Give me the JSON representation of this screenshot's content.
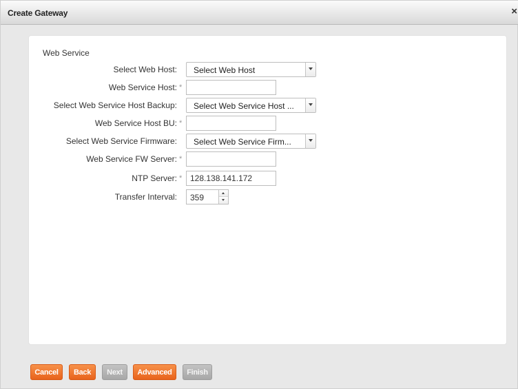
{
  "window": {
    "title": "Create Gateway",
    "close_glyph": "×"
  },
  "form": {
    "section_title": "Web Service",
    "required_mark": "*",
    "select_web_host": {
      "label": "Select Web Host:",
      "value": "Select Web Host"
    },
    "web_service_host": {
      "label": "Web Service Host:",
      "value": ""
    },
    "select_host_backup": {
      "label": "Select Web Service Host Backup:",
      "value": "Select Web Service Host ..."
    },
    "web_service_host_bu": {
      "label": "Web Service Host BU:",
      "value": ""
    },
    "select_firmware": {
      "label": "Select Web Service Firmware:",
      "value": "Select Web Service Firm..."
    },
    "fw_server": {
      "label": "Web Service FW Server:",
      "value": ""
    },
    "ntp_server": {
      "label": "NTP Server:",
      "value": "128.138.141.172"
    },
    "transfer_interval": {
      "label": "Transfer Interval:",
      "value": "359"
    }
  },
  "footer": {
    "cancel": "Cancel",
    "back": "Back",
    "next": "Next",
    "advanced": "Advanced",
    "finish": "Finish"
  },
  "colors": {
    "accent_orange": "#ee6f26",
    "disabled_gray": "#b5b5b5"
  }
}
